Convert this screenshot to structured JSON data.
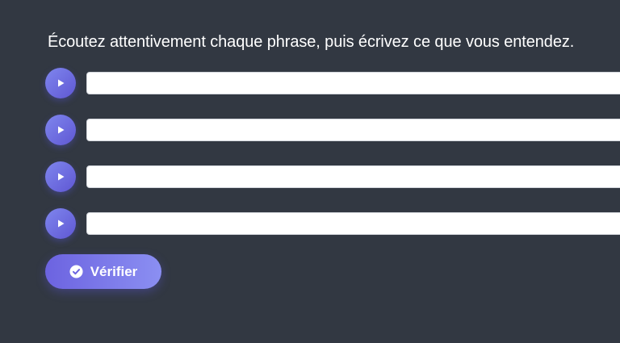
{
  "instruction": "Écoutez attentivement chaque phrase, puis écrivez ce que vous entendez.",
  "sentences": [
    {
      "play_icon": "play-icon",
      "answer_value": ""
    },
    {
      "play_icon": "play-icon",
      "answer_value": ""
    },
    {
      "play_icon": "play-icon",
      "answer_value": ""
    },
    {
      "play_icon": "play-icon",
      "answer_value": ""
    }
  ],
  "verify_button": {
    "label": "Vérifier",
    "icon": "check-circle-icon"
  },
  "colors": {
    "background": "#323842",
    "accent_start": "#6c63e0",
    "accent_end": "#8b8ff2",
    "text": "#ffffff",
    "input_background": "#ffffff"
  }
}
